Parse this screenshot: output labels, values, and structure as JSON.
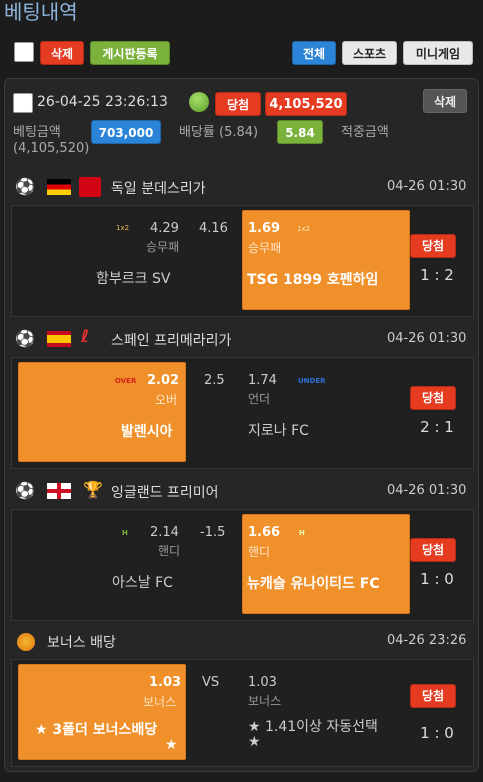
{
  "page_title": "베팅내역",
  "toolbar": {
    "delete": "삭제",
    "board": "게시판등록",
    "all": "전체",
    "sports": "스포츠",
    "minigame": "미니게임"
  },
  "bet": {
    "datetime": "26-04-25 23:26:13",
    "status": "당첨",
    "payout_badge": "4,105,520",
    "delete": "삭제",
    "amount_label": "베팅금액",
    "amount": "703,000",
    "rate_label": "배당률 (5.84)",
    "rate": "5.84",
    "win_label": "적중금액",
    "win_amount": "(4,105,520)"
  },
  "games": [
    {
      "league": "독일 분데스리가",
      "time": "04-26 01:30",
      "left_odds": "4.29",
      "left_sub": "승무패",
      "left_mark": "1x2",
      "mid": "4.16",
      "right_odds": "1.69",
      "right_sub": "승무패",
      "right_mark": "1x2",
      "home": "함부르크 SV",
      "away": "TSG 1899 호펜하임",
      "result": "당첨",
      "score": "1 : 2"
    },
    {
      "league": "스페인 프리메라리가",
      "time": "04-26 01:30",
      "left_odds": "2.02",
      "left_sub": "오버",
      "left_mark": "OVER",
      "mid": "2.5",
      "right_odds": "1.74",
      "right_sub": "언더",
      "right_mark": "UNDER",
      "home": "발렌시아",
      "away": "지로나 FC",
      "result": "당첨",
      "score": "2 : 1"
    },
    {
      "league": "잉글랜드 프리미어",
      "time": "04-26 01:30",
      "left_odds": "2.14",
      "left_sub": "핸디",
      "left_mark": "H",
      "mid": "-1.5",
      "right_odds": "1.66",
      "right_sub": "핸디",
      "right_mark": "H",
      "home": "아스날 FC",
      "away": "뉴캐슬 유나이티드 FC",
      "result": "당첨",
      "score": "1 : 0"
    },
    {
      "league": "보너스 배당",
      "time": "04-26 23:26",
      "left_odds": "1.03",
      "left_sub": "보너스",
      "mid": "VS",
      "right_odds": "1.03",
      "right_sub": "보너스",
      "home_line1": "★ 3폴더 보너스배당",
      "home_line2": "★",
      "away_line1": "★ 1.41이상 자동선택",
      "away_line2": "★",
      "result": "당첨",
      "score": "1 : 0"
    }
  ]
}
